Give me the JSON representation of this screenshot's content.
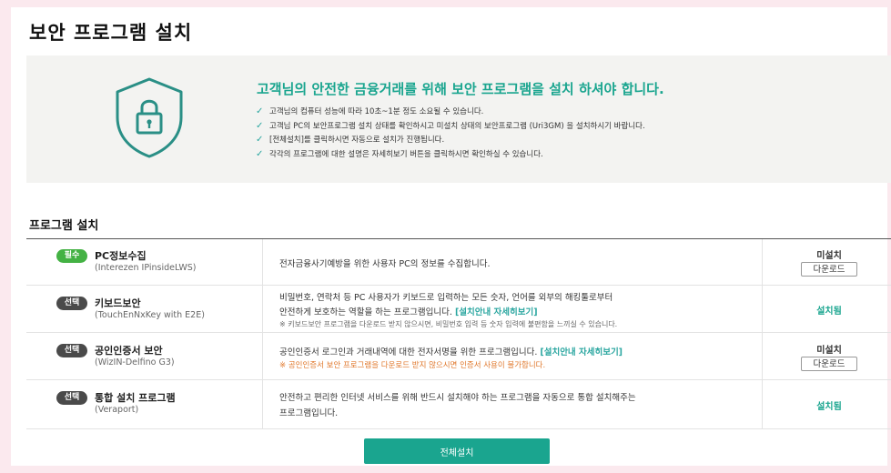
{
  "page": {
    "title": "보안 프로그램 설치"
  },
  "banner": {
    "icon": "lock-shield-icon",
    "headline": "고객님의 안전한 금융거래를 위해 보안 프로그램을 설치 하셔야 합니다.",
    "notes": [
      "고객님의 컴퓨터 성능에 따라 10초~1분 정도 소요될 수 있습니다.",
      "고객님 PC의 보안프로그램 설치 상태를 확인하시고 미설치 상태의 보안프로그램 (Uri3GM) 을 설치하시기 바랍니다.",
      "[전체설치]를 클릭하시면 자동으로 설치가 진행됩니다.",
      "각각의 프로그램에 대한 설명은 자세히보기 버튼을 클릭하시면 확인하실 수 있습니다."
    ]
  },
  "section": {
    "title": "프로그램 설치"
  },
  "programs": [
    {
      "badge": "필수",
      "name": "PC정보수집",
      "sub": "(Interezen IPinsideLWS)",
      "desc_line1": "전자금융사기예방을 위한 사용자 PC의 정보를 수집합니다.",
      "status": "미설치",
      "download": "다운로드"
    },
    {
      "badge": "선택",
      "name": "키보드보안",
      "sub": "(TouchEnNxKey with E2E)",
      "desc_line1": "비밀번호, 연락처 등 PC 사용자가 키보드로 입력하는 모든 숫자, 언어를 외부의 해킹툴로부터",
      "desc_line2": "안전하게 보호하는 역할을 하는 프로그램입니다.",
      "link": "[설치안내 자세히보기]",
      "note": "※ 키보드보안 프로그램을 다운로드 받지 않으시면, 비밀번호 입력 등 숫자 입력에 불편함을 느끼실 수 있습니다.",
      "status": "설치됨"
    },
    {
      "badge": "선택",
      "name": "공인인증서 보안",
      "sub": "(WizIN-Delfino G3)",
      "desc_line1": "공인인증서 로그인과 거래내역에 대한 전자서명을 위한 프로그램입니다.",
      "link": "[설치안내 자세히보기]",
      "warning": "※ 공인인증서 보안 프로그램을 다운로드 받지 않으시면 인증서 사용이 불가합니다.",
      "status": "미설치",
      "download": "다운로드"
    },
    {
      "badge": "선택",
      "name": "통합 설치 프로그램",
      "sub": "(Veraport)",
      "desc_line1": "안전하고 편리한 인터넷 서비스를 위해 반드시 설치해야 하는 프로그램을 자동으로 통합 설치해주는",
      "desc_line2": "프로그램입니다.",
      "status": "설치됨"
    }
  ],
  "actions": {
    "install_all": "전체설치"
  },
  "colors": {
    "accent": "#1aa58f",
    "required_badge": "#44b244",
    "optional_badge": "#4a4a4a",
    "warning": "#e0782c"
  }
}
